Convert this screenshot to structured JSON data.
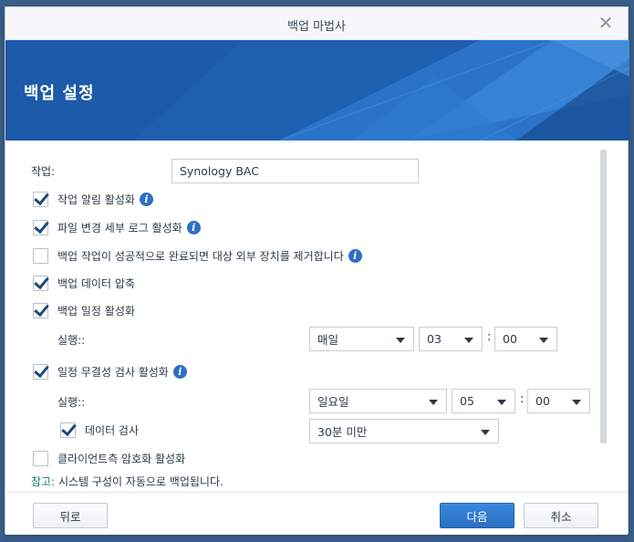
{
  "window": {
    "title": "백업 마법사",
    "close_glyph": "✕"
  },
  "banner": {
    "title": "백업 설정",
    "colors": {
      "base": "#1f5fb0",
      "light": "#3a86d8",
      "dark": "#174a8f"
    }
  },
  "form": {
    "task_label": "작업:",
    "task_value": "Synology BAC",
    "options": [
      {
        "label": "작업 알림 활성화",
        "checked": true,
        "info": true
      },
      {
        "label": "파일 변경 세부 로그 활성화",
        "checked": true,
        "info": true
      },
      {
        "label": "백업 작업이 성공적으로 완료되면 대상 외부 장치를 제거합니다",
        "checked": false,
        "info": true
      },
      {
        "label": "백업 데이터 압축",
        "checked": true,
        "info": false
      },
      {
        "label": "백업 일정 활성화",
        "checked": true,
        "info": false
      }
    ],
    "schedule": {
      "run_label": "실행::",
      "frequency": "매일",
      "hour": "03",
      "minute": "00",
      "separator": ":"
    },
    "integrity": {
      "label": "일정 무결성 검사 활성화",
      "checked": true,
      "run_label": "실행::",
      "day": "일요일",
      "hour": "05",
      "minute": "00",
      "separator": ":",
      "data_check_label": "데이터 검사",
      "data_check_checked": true,
      "duration": "30분 미만"
    },
    "client_encryption": {
      "label": "클라이언트측 암호화 활성화",
      "checked": false
    },
    "note": {
      "key": "참고:",
      "text": " 시스템 구성이 자동으로 백업됩니다."
    },
    "info_glyph": "i"
  },
  "footer": {
    "back_label": "뒤로",
    "next_label": "다음",
    "cancel_label": "취소"
  }
}
